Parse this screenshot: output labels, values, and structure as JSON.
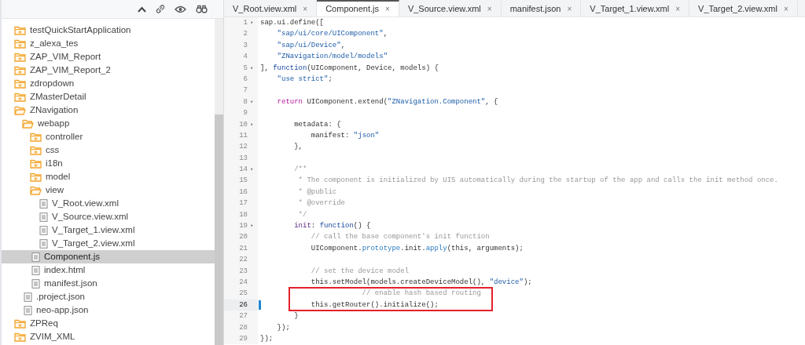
{
  "sidebar": {
    "tree": [
      {
        "kind": "folder",
        "label": "testQuickStartApplication",
        "expanded": false,
        "selected": false
      },
      {
        "kind": "folder",
        "label": "z_alexa_tes",
        "expanded": false,
        "selected": false
      },
      {
        "kind": "folder",
        "label": "ZAP_VIM_Report",
        "expanded": false,
        "selected": false
      },
      {
        "kind": "folder",
        "label": "ZAP_VIM_Report_2",
        "expanded": false,
        "selected": false
      },
      {
        "kind": "folder",
        "label": "zdropdown",
        "expanded": false,
        "selected": false
      },
      {
        "kind": "folder",
        "label": "ZMasterDetail",
        "expanded": false,
        "selected": false
      },
      {
        "kind": "folder",
        "label": "ZNavigation",
        "expanded": true,
        "selected": false,
        "children": [
          {
            "kind": "folder",
            "label": "webapp",
            "expanded": true,
            "selected": false,
            "children": [
              {
                "kind": "folder",
                "label": "controller",
                "expanded": false,
                "selected": false
              },
              {
                "kind": "folder",
                "label": "css",
                "expanded": false,
                "selected": false
              },
              {
                "kind": "folder",
                "label": "i18n",
                "expanded": false,
                "selected": false
              },
              {
                "kind": "folder",
                "label": "model",
                "expanded": false,
                "selected": false
              },
              {
                "kind": "folder",
                "label": "view",
                "expanded": true,
                "selected": false,
                "children": [
                  {
                    "kind": "file",
                    "label": "V_Root.view.xml",
                    "selected": false
                  },
                  {
                    "kind": "file",
                    "label": "V_Source.view.xml",
                    "selected": false
                  },
                  {
                    "kind": "file",
                    "label": "V_Target_1.view.xml",
                    "selected": false
                  },
                  {
                    "kind": "file",
                    "label": "V_Target_2.view.xml",
                    "selected": false
                  }
                ]
              },
              {
                "kind": "file",
                "label": "Component.js",
                "selected": true
              },
              {
                "kind": "file",
                "label": "index.html",
                "selected": false
              },
              {
                "kind": "file",
                "label": "manifest.json",
                "selected": false
              }
            ]
          },
          {
            "kind": "file",
            "label": ".project.json",
            "selected": false
          },
          {
            "kind": "file",
            "label": "neo-app.json",
            "selected": false
          }
        ]
      },
      {
        "kind": "folder",
        "label": "ZPReq",
        "expanded": false,
        "selected": false
      },
      {
        "kind": "folder",
        "label": "ZVIM_XML",
        "expanded": false,
        "selected": false
      }
    ]
  },
  "tabs": [
    {
      "label": "V_Root.view.xml",
      "close": "×",
      "selected": false
    },
    {
      "label": "Component.js",
      "close": "×",
      "selected": true
    },
    {
      "label": "V_Source.view.xml",
      "close": "×",
      "selected": false
    },
    {
      "label": "manifest.json",
      "close": "×",
      "selected": false
    },
    {
      "label": "V_Target_1.view.xml",
      "close": "×",
      "selected": false
    },
    {
      "label": "V_Target_2.view.xml",
      "close": "×",
      "selected": false
    }
  ],
  "editor": {
    "lines": [
      {
        "number": "1",
        "fold": "▾",
        "active": false,
        "boxed": false,
        "parts": [
          {
            "kind": "plain",
            "text": "sap.ui.define(["
          }
        ]
      },
      {
        "number": "2",
        "active": false,
        "boxed": false,
        "parts": [
          {
            "kind": "string",
            "text": "    \"sap/ui/core/UIComponent\""
          },
          {
            "kind": "plain",
            "text": ","
          }
        ]
      },
      {
        "number": "3",
        "active": false,
        "boxed": false,
        "parts": [
          {
            "kind": "string",
            "text": "    \"sap/ui/Device\""
          },
          {
            "kind": "plain",
            "text": ","
          }
        ]
      },
      {
        "number": "4",
        "active": false,
        "boxed": false,
        "parts": [
          {
            "kind": "string",
            "text": "    \"ZNavigation/model/models\""
          }
        ]
      },
      {
        "number": "5",
        "fold": "▾",
        "active": false,
        "boxed": false,
        "parts": [
          {
            "kind": "plain",
            "text": "], "
          },
          {
            "kind": "keyword",
            "text": "function"
          },
          {
            "kind": "plain",
            "text": "(UIComponent, Device, models) {"
          }
        ]
      },
      {
        "number": "6",
        "active": false,
        "boxed": false,
        "parts": [
          {
            "kind": "string",
            "text": "    \"use strict\""
          },
          {
            "kind": "plain",
            "text": ";"
          }
        ]
      },
      {
        "number": "7",
        "active": false,
        "boxed": false
      },
      {
        "number": "8",
        "fold": "▾",
        "active": false,
        "boxed": false,
        "parts": [
          {
            "kind": "control",
            "text": "    return"
          },
          {
            "kind": "plain",
            "text": " UIComponent.extend("
          },
          {
            "kind": "string",
            "text": "\"ZNavigation.Component\""
          },
          {
            "kind": "plain",
            "text": ", {"
          }
        ]
      },
      {
        "number": "9",
        "active": false,
        "boxed": false
      },
      {
        "number": "10",
        "fold": "▾",
        "active": false,
        "boxed": false,
        "parts": [
          {
            "kind": "plain",
            "text": "        metadata: {"
          }
        ]
      },
      {
        "number": "11",
        "active": false,
        "boxed": false,
        "parts": [
          {
            "kind": "plain",
            "text": "            manifest: "
          },
          {
            "kind": "string",
            "text": "\"json\""
          }
        ]
      },
      {
        "number": "12",
        "active": false,
        "boxed": false,
        "parts": [
          {
            "kind": "plain",
            "text": "        },"
          }
        ]
      },
      {
        "number": "13",
        "active": false,
        "boxed": false
      },
      {
        "number": "14",
        "fold": "▾",
        "active": false,
        "boxed": false,
        "parts": [
          {
            "kind": "comment",
            "text": "        /**"
          }
        ]
      },
      {
        "number": "15",
        "active": false,
        "boxed": false,
        "parts": [
          {
            "kind": "comment",
            "text": "         * The component is initialized by UI5 automatically during the startup of the app and calls the init method once."
          }
        ]
      },
      {
        "number": "16",
        "active": false,
        "boxed": false,
        "parts": [
          {
            "kind": "comment",
            "text": "         * @public"
          }
        ]
      },
      {
        "number": "17",
        "active": false,
        "boxed": false,
        "parts": [
          {
            "kind": "comment",
            "text": "         * @override"
          }
        ]
      },
      {
        "number": "18",
        "active": false,
        "boxed": false,
        "parts": [
          {
            "kind": "comment",
            "text": "         */"
          }
        ]
      },
      {
        "number": "19",
        "fold": "▾",
        "active": false,
        "boxed": false,
        "parts": [
          {
            "kind": "property",
            "text": "        init"
          },
          {
            "kind": "plain",
            "text": ": "
          },
          {
            "kind": "keyword",
            "text": "function"
          },
          {
            "kind": "plain",
            "text": "() {"
          }
        ]
      },
      {
        "number": "20",
        "active": false,
        "boxed": false,
        "parts": [
          {
            "kind": "comment",
            "text": "            // call the base component's init function"
          }
        ]
      },
      {
        "number": "21",
        "active": false,
        "boxed": false,
        "parts": [
          {
            "kind": "plain",
            "text": "            UIComponent."
          },
          {
            "kind": "builtin",
            "text": "prototype"
          },
          {
            "kind": "plain",
            "text": ".init."
          },
          {
            "kind": "builtin",
            "text": "apply"
          },
          {
            "kind": "plain",
            "text": "(this, arguments);"
          }
        ]
      },
      {
        "number": "22",
        "active": false,
        "boxed": false
      },
      {
        "number": "23",
        "active": false,
        "boxed": false,
        "parts": [
          {
            "kind": "comment",
            "text": "            // set the device model"
          }
        ]
      },
      {
        "number": "24",
        "active": false,
        "boxed": false,
        "parts": [
          {
            "kind": "plain",
            "text": "            this.setModel(models.createDeviceModel(), "
          },
          {
            "kind": "string",
            "text": "\"device\""
          },
          {
            "kind": "plain",
            "text": ");"
          }
        ]
      },
      {
        "number": "25",
        "active": false,
        "boxed": true,
        "parts": [
          {
            "kind": "comment",
            "text": "                        // enable hash based routing"
          }
        ]
      },
      {
        "number": "26",
        "active": true,
        "boxed": true,
        "parts": [
          {
            "kind": "plain",
            "text": "            this.getRouter().initialize();"
          }
        ]
      },
      {
        "number": "27",
        "active": false,
        "boxed": false,
        "parts": [
          {
            "kind": "plain",
            "text": "        }"
          }
        ]
      },
      {
        "number": "28",
        "active": false,
        "boxed": false,
        "parts": [
          {
            "kind": "plain",
            "text": "    });"
          }
        ]
      },
      {
        "number": "29",
        "active": false,
        "boxed": false,
        "parts": [
          {
            "kind": "plain",
            "text": "});"
          }
        ]
      }
    ]
  }
}
